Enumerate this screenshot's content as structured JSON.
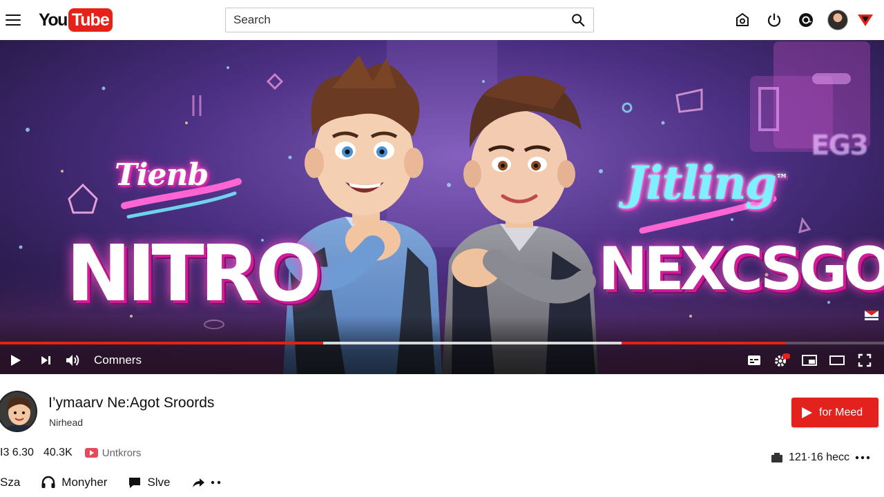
{
  "header": {
    "logo_you": "You",
    "logo_tube": "Tube",
    "search_placeholder": "Search",
    "icons": [
      "menu-icon",
      "search-icon",
      "camera-icon",
      "power-icon",
      "at-sign-icon",
      "avatar",
      "notification-flag-icon"
    ]
  },
  "video": {
    "thumbnail": {
      "left_small": "Tienb",
      "left_big": "NITRO",
      "right_small": "Jitling",
      "right_tm": "™",
      "right_big": "NEXCSGO",
      "sign": "EG3"
    },
    "progress": {
      "played": 0.366,
      "buffered": 0.703,
      "ad_start": 0.703,
      "ad_end": 0.889
    },
    "controls": {
      "time_label": "Comners",
      "left_icons": [
        "play-icon",
        "next-icon",
        "volume-icon"
      ],
      "right_icons": [
        "subtitles-icon",
        "settings-icon",
        "miniplayer-icon",
        "theater-icon",
        "fullscreen-icon"
      ]
    }
  },
  "info": {
    "title": "I’ymaarv Ne:Agot Sroords",
    "channel": "Nirhead",
    "subscribe_label": "for Meed",
    "stats": {
      "views": "I3 6.30",
      "likes": "40.3K",
      "badge_label": "Untkrors"
    },
    "date": "121·16 hecc",
    "actions": [
      {
        "label": "Sza",
        "icon": "share-arrow-icon"
      },
      {
        "label": "Monyher",
        "icon": "headphones-icon"
      },
      {
        "label": "Slve",
        "icon": "comment-icon"
      },
      {
        "label": "",
        "icon": "forward-icon"
      }
    ]
  },
  "colors": {
    "brand_red": "#e62117",
    "subscribe_red": "#e3211d",
    "neon_pink": "#ff2fb9",
    "neon_cyan": "#7ef0ff"
  }
}
